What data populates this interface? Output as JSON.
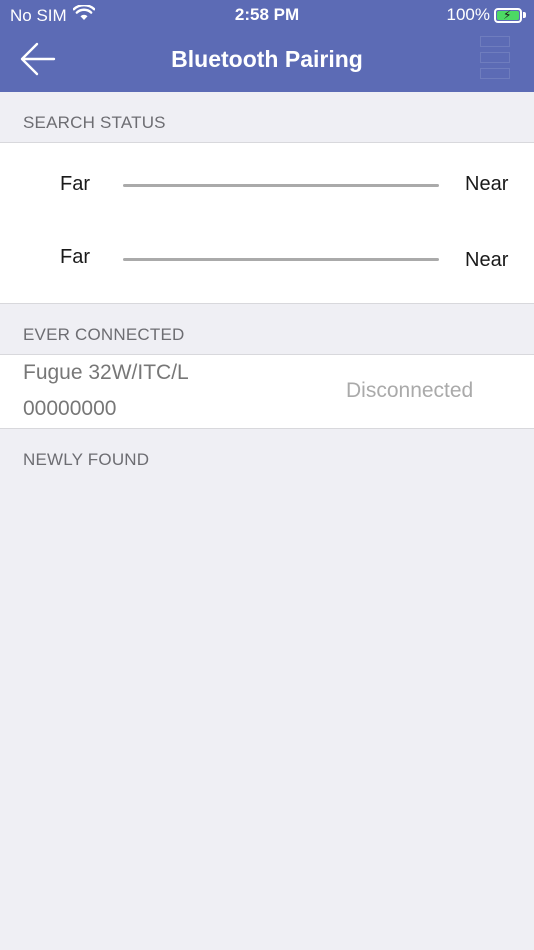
{
  "status_bar": {
    "carrier": "No SIM",
    "time": "2:58 PM",
    "battery": "100%"
  },
  "nav": {
    "title": "Bluetooth Pairing"
  },
  "sections": {
    "search_status": "SEARCH STATUS",
    "ever_connected": "EVER CONNECTED",
    "newly_found": "NEWLY FOUND"
  },
  "signal_rows": [
    {
      "far_label": "Far",
      "near_label": "Near"
    },
    {
      "far_label": "Far",
      "near_label": "Near"
    }
  ],
  "devices": [
    {
      "name": "Fugue 32W/ITC/L",
      "id": "00000000",
      "status": "Disconnected"
    }
  ],
  "colors": {
    "header": "#5c6bb5",
    "background": "#efeff4",
    "battery_fill": "#4cd964"
  }
}
